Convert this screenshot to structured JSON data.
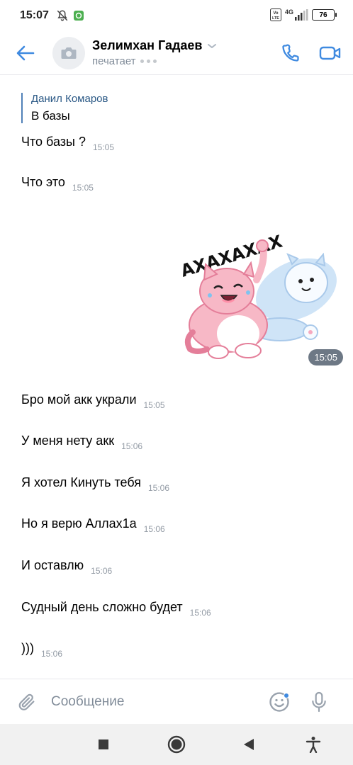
{
  "status_bar": {
    "time": "15:07",
    "network": "4G",
    "volte": "Vo LTE",
    "battery": "76"
  },
  "header": {
    "title": "Зелимхан Гадаев",
    "status": "печатает",
    "accent_color": "#3f8ae0"
  },
  "reply": {
    "author": "Данил Комаров",
    "text": "В базы"
  },
  "messages": [
    {
      "text": "Что базы ?",
      "time": "15:05"
    },
    {
      "text": "Что это",
      "time": "15:05"
    },
    {
      "text": "Бро мой акк украли",
      "time": "15:05"
    },
    {
      "text": "У меня нету акк",
      "time": "15:06"
    },
    {
      "text": "Я хотел Кинуть тебя",
      "time": "15:06"
    },
    {
      "text": "Но я верю Аллах1а",
      "time": "15:06"
    },
    {
      "text": "И оставлю",
      "time": "15:06"
    },
    {
      "text": "Судный день сложно будет",
      "time": "15:06"
    },
    {
      "text": ")))",
      "time": "15:06"
    }
  ],
  "sticker": {
    "caption": "АХАХАХАХ",
    "time": "15:05"
  },
  "composer": {
    "placeholder": "Сообщение"
  }
}
